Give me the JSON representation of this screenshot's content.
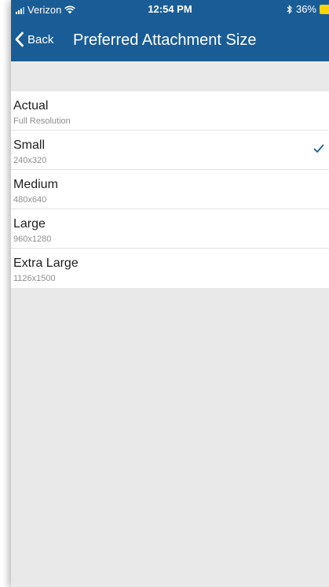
{
  "status_bar": {
    "carrier": "Verizon",
    "time": "12:54 PM",
    "battery": "36%"
  },
  "nav": {
    "back_label": "Back",
    "title": "Preferred Attachment Size"
  },
  "options": [
    {
      "label": "Actual",
      "detail": "Full Resolution",
      "selected": false
    },
    {
      "label": "Small",
      "detail": "240x320",
      "selected": true
    },
    {
      "label": "Medium",
      "detail": "480x640",
      "selected": false
    },
    {
      "label": "Large",
      "detail": "960x1280",
      "selected": false
    },
    {
      "label": "Extra Large",
      "detail": "1126x1500",
      "selected": false
    }
  ],
  "colors": {
    "nav_background": "#1a5d96",
    "checkmark": "#1a5d96",
    "battery": "#ffd400",
    "page_background": "#e9e9e9"
  },
  "icons": {
    "signal": "signal-bars-icon",
    "wifi": "wifi-icon",
    "bluetooth": "bluetooth-icon",
    "battery": "battery-icon",
    "back": "chevron-left-icon",
    "selected": "checkmark-icon"
  }
}
